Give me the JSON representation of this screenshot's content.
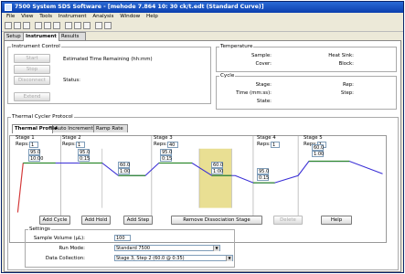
{
  "window": {
    "title": "7500 System SDS Software - [mehode 7.864 10: 30 ck/t.edt (Standard Curve)]"
  },
  "menu": [
    "File",
    "View",
    "Tools",
    "Instrument",
    "Analysis",
    "Window",
    "Help"
  ],
  "toolbar_icons": [
    "new-icon",
    "open-icon",
    "save-icon",
    "print-icon",
    "cut-icon",
    "copy-icon",
    "paste-icon",
    "grid-icon",
    "run-icon",
    "find-icon",
    "help-icon"
  ],
  "tabs": [
    "Setup",
    "Instrument",
    "Results"
  ],
  "instrument_control": {
    "title": "Instrument Control",
    "buttons": [
      "Start",
      "Stop",
      "Disconnect",
      "Extend"
    ],
    "time_label": "Estimated Time Remaining (hh:mm)",
    "status_label": "Status:"
  },
  "temperature": {
    "title": "Temperature",
    "sample": "Sample:",
    "cover": "Cover:",
    "heat_sink": "Heat Sink:",
    "block": "Block:"
  },
  "cycle": {
    "title": "Cycle",
    "stage": "Stage:",
    "rep": "Rep:",
    "time": "Time (mm:ss):",
    "step": "Step:",
    "state": "State:"
  },
  "protocol": {
    "title": "Thermal Cycler Protocol",
    "subtabs": [
      "Thermal Profile",
      "Auto Increment",
      "Ramp Rate"
    ],
    "stages": [
      {
        "name": "Stage 1",
        "reps": "1"
      },
      {
        "name": "Stage 2",
        "reps": "1"
      },
      {
        "name": "Stage 3",
        "reps": "40"
      },
      {
        "name": "Stage 4",
        "reps": "1"
      },
      {
        "name": "Stage 5",
        "reps": "1"
      }
    ],
    "stage_label": "Stage",
    "reps_label": "Reps:",
    "steps": [
      {
        "temp": "95.0",
        "time": "10:00"
      },
      {
        "temp": "95.0",
        "time": "0:15"
      },
      {
        "temp": "60.0",
        "time": "1:00"
      },
      {
        "temp": "95.0",
        "time": "0:15"
      },
      {
        "temp": "60.0",
        "time": "1:00"
      },
      {
        "temp": "95.0",
        "time": "0:15"
      },
      {
        "temp": "60.0",
        "time": "1:00"
      },
      {
        "temp": "95.0",
        "time": "0:15"
      }
    ],
    "buttons": {
      "add_cycle": "Add Cycle",
      "add_hold": "Add Hold",
      "add_step": "Add Step",
      "remove_diss": "Remove Dissociation Stage",
      "delete": "Delete",
      "help": "Help"
    }
  },
  "settings": {
    "title": "Settings",
    "sample_volume_label": "Sample Volume (µL):",
    "sample_volume": "100",
    "run_mode_label": "Run Mode:",
    "run_mode": "Standard 7500",
    "data_collection_label": "Data Collection:",
    "data_collection": "Stage 3, Step 2 (60.0 @ 0:35)"
  },
  "colors": {
    "ramp_line": "#3a2fd6",
    "hold_line": "#2f8a2f",
    "start_ramp": "#d43a3a",
    "highlight": "#e9df93"
  }
}
